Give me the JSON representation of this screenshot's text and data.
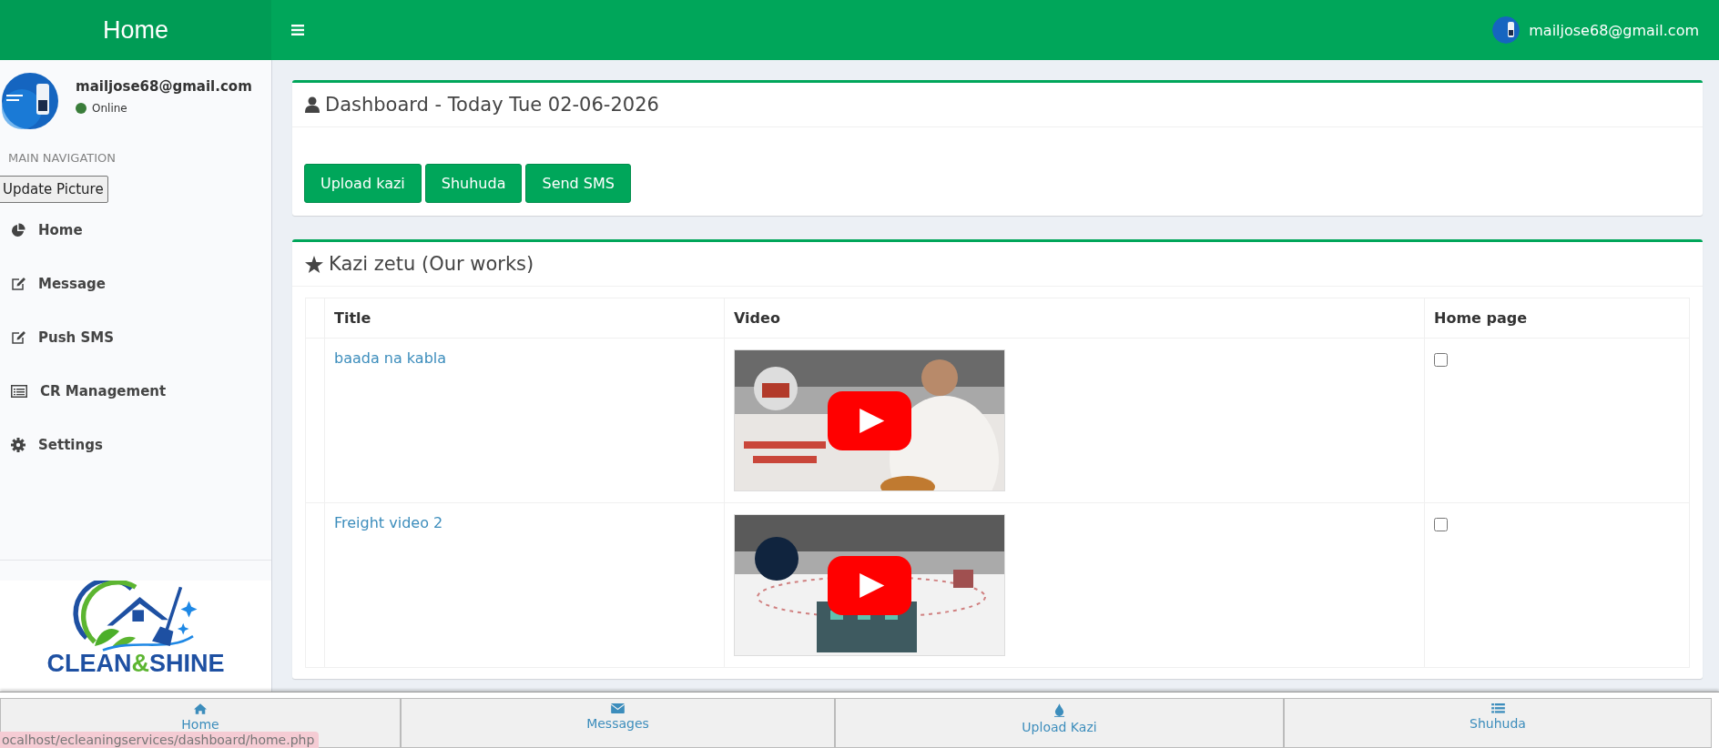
{
  "header": {
    "brand": "Home",
    "user_email": "mailjose68@gmail.com"
  },
  "sidebar": {
    "user": {
      "email": "mailjose68@gmail.com",
      "status": "Online",
      "online": true
    },
    "section_label": "MAIN NAVIGATION",
    "update_button": "Update Picture",
    "items": [
      {
        "label": "Home"
      },
      {
        "label": "Message"
      },
      {
        "label": "Push SMS"
      },
      {
        "label": "CR Management"
      },
      {
        "label": "Settings"
      }
    ],
    "logo": {
      "word_1": "CLEAN",
      "joiner": "&",
      "word_2": "SHINE"
    }
  },
  "dashboard": {
    "title": "Dashboard - Today Tue 02-06-2026",
    "buttons": [
      "Upload kazi",
      "Shuhuda",
      "Send SMS"
    ]
  },
  "works": {
    "title": "Kazi zetu (Our works)",
    "columns": [
      "Title",
      "Video",
      "Home page"
    ],
    "rows": [
      {
        "title": "baada na kabla",
        "home_page": false
      },
      {
        "title": "Freight video 2",
        "home_page": false
      }
    ]
  },
  "bottom_nav": [
    {
      "label": "Home"
    },
    {
      "label": "Messages"
    },
    {
      "label": "Upload Kazi"
    },
    {
      "label": "Shuhuda"
    }
  ],
  "status_url": "ocalhost/ecleaningservices/dashboard/home.php"
}
